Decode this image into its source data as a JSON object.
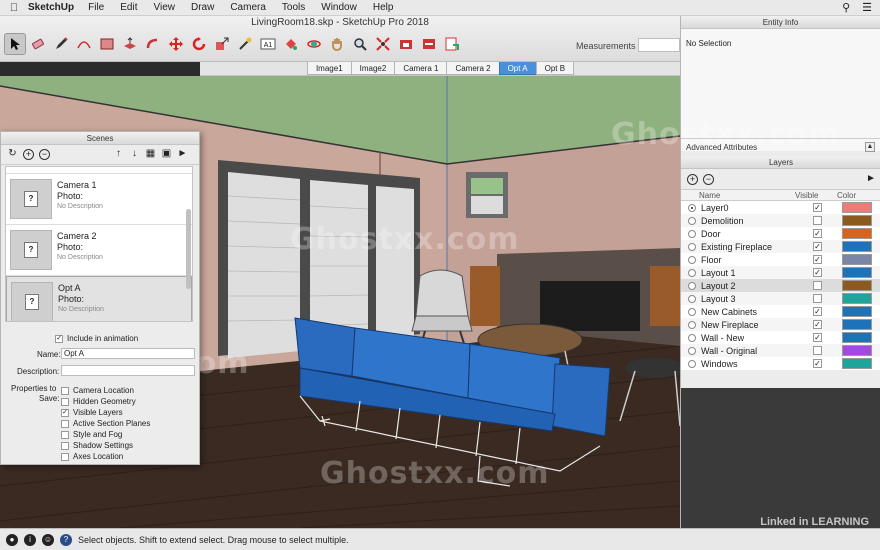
{
  "menubar": {
    "app_name": "SketchUp",
    "items": [
      "File",
      "Edit",
      "View",
      "Draw",
      "Camera",
      "Tools",
      "Window",
      "Help"
    ]
  },
  "window": {
    "title": "LivingRoom18.skp - SketchUp Pro 2018"
  },
  "toolbar": {
    "measurements_label": "Measurements",
    "tools": [
      "select",
      "eraser",
      "pencil",
      "arc",
      "rectangle",
      "push-pull",
      "follow-me",
      "move",
      "rotate",
      "scale",
      "tape-measure",
      "text",
      "paint-bucket",
      "orbit",
      "pan",
      "zoom",
      "zoom-extents",
      "warehouse",
      "extension-warehouse",
      "layout"
    ]
  },
  "scene_tabs": [
    "Image1",
    "Image2",
    "Camera 1",
    "Camera 2",
    "Opt A",
    "Opt B"
  ],
  "selected_scene_tab": "Opt A",
  "entity_info": {
    "title": "Entity Info",
    "selection": "No Selection",
    "advanced_label": "Advanced Attributes"
  },
  "layers": {
    "title": "Layers",
    "col_name": "Name",
    "col_visible": "Visible",
    "col_color": "Color",
    "rows": [
      {
        "name": "Layer0",
        "active": true,
        "visible": true,
        "color": "#f07a78"
      },
      {
        "name": "Demolition",
        "active": false,
        "visible": false,
        "color": "#8a5a1e"
      },
      {
        "name": "Door",
        "active": false,
        "visible": true,
        "color": "#d8641c"
      },
      {
        "name": "Existing Fireplace",
        "active": false,
        "visible": true,
        "color": "#1e72b8"
      },
      {
        "name": "Floor",
        "active": false,
        "visible": true,
        "color": "#7a86a8"
      },
      {
        "name": "Layout 1",
        "active": false,
        "visible": true,
        "color": "#1e72b8"
      },
      {
        "name": "Layout 2",
        "active": false,
        "visible": false,
        "color": "#8a5a1e"
      },
      {
        "name": "Layout 3",
        "active": false,
        "visible": false,
        "color": "#1ea49a"
      },
      {
        "name": "New Cabinets",
        "active": false,
        "visible": true,
        "color": "#1e72b8"
      },
      {
        "name": "New Fireplace",
        "active": false,
        "visible": true,
        "color": "#1e72b8"
      },
      {
        "name": "Wall - New",
        "active": false,
        "visible": true,
        "color": "#1e72b8"
      },
      {
        "name": "Wall - Original",
        "active": false,
        "visible": false,
        "color": "#a648e0"
      },
      {
        "name": "Windows",
        "active": false,
        "visible": true,
        "color": "#1ea49a"
      }
    ]
  },
  "scenes": {
    "title": "Scenes",
    "items": [
      {
        "name": "Camera 1",
        "photo": "Photo:",
        "desc": "No Description"
      },
      {
        "name": "Camera 2",
        "photo": "Photo:",
        "desc": "No Description"
      },
      {
        "name": "Opt A",
        "photo": "Photo:",
        "desc": "No Description"
      }
    ],
    "include_label": "Include in animation",
    "name_label": "Name:",
    "name_value": "Opt A",
    "desc_label": "Description:",
    "props_label_1": "Properties to",
    "props_label_2": "Save:",
    "properties": [
      {
        "label": "Camera Location",
        "checked": false
      },
      {
        "label": "Hidden Geometry",
        "checked": false
      },
      {
        "label": "Visible Layers",
        "checked": true
      },
      {
        "label": "Active Section Planes",
        "checked": false
      },
      {
        "label": "Style and Fog",
        "checked": false
      },
      {
        "label": "Shadow Settings",
        "checked": false
      },
      {
        "label": "Axes Location",
        "checked": false
      }
    ]
  },
  "status": {
    "text": "Select objects. Shift to extend select. Drag mouse to select multiple."
  },
  "watermark": "Ghostxx.com",
  "linkedin": "Linked in LEARNING",
  "check_mark": "✓"
}
